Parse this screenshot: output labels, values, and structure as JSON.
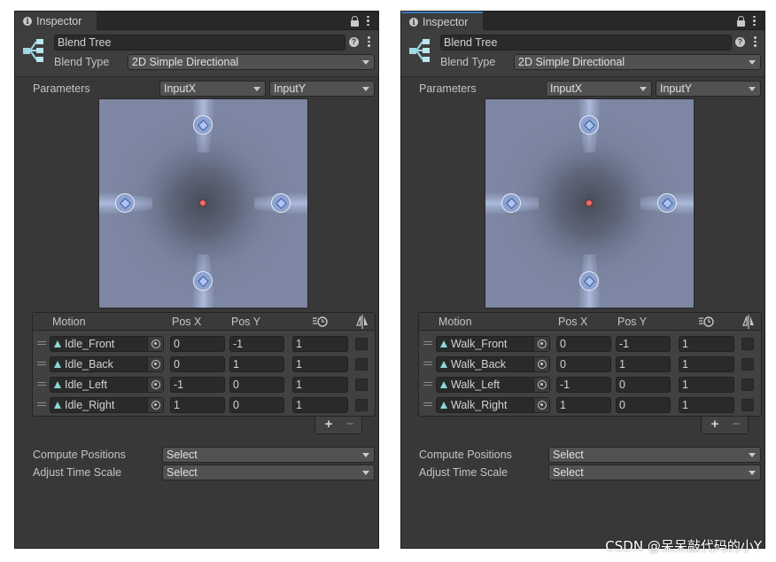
{
  "panels": [
    {
      "tab_label": "Inspector",
      "name": "Blend Tree",
      "blend_type_label": "Blend Type",
      "blend_type_value": "2D Simple Directional",
      "parameters_label": "Parameters",
      "param_x": "InputX",
      "param_y": "InputY",
      "columns": {
        "motion": "Motion",
        "pos_x": "Pos X",
        "pos_y": "Pos Y"
      },
      "motions": [
        {
          "clip": "Idle_Front",
          "pos_x": "0",
          "pos_y": "-1",
          "speed": "1"
        },
        {
          "clip": "Idle_Back",
          "pos_x": "0",
          "pos_y": "1",
          "speed": "1"
        },
        {
          "clip": "Idle_Left",
          "pos_x": "-1",
          "pos_y": "0",
          "speed": "1"
        },
        {
          "clip": "Idle_Right",
          "pos_x": "1",
          "pos_y": "0",
          "speed": "1"
        }
      ],
      "add_label": "+",
      "remove_label": "−",
      "compute_positions_label": "Compute Positions",
      "compute_positions_value": "Select",
      "adjust_time_scale_label": "Adjust Time Scale",
      "adjust_time_scale_value": "Select"
    },
    {
      "tab_label": "Inspector",
      "name": "Blend Tree",
      "blend_type_label": "Blend Type",
      "blend_type_value": "2D Simple Directional",
      "parameters_label": "Parameters",
      "param_x": "InputX",
      "param_y": "InputY",
      "columns": {
        "motion": "Motion",
        "pos_x": "Pos X",
        "pos_y": "Pos Y"
      },
      "motions": [
        {
          "clip": "Walk_Front",
          "pos_x": "0",
          "pos_y": "-1",
          "speed": "1"
        },
        {
          "clip": "Walk_Back",
          "pos_x": "0",
          "pos_y": "1",
          "speed": "1"
        },
        {
          "clip": "Walk_Left",
          "pos_x": "-1",
          "pos_y": "0",
          "speed": "1"
        },
        {
          "clip": "Walk_Right",
          "pos_x": "1",
          "pos_y": "0",
          "speed": "1"
        }
      ],
      "add_label": "+",
      "remove_label": "−",
      "compute_positions_label": "Compute Positions",
      "compute_positions_value": "Select",
      "adjust_time_scale_label": "Adjust Time Scale",
      "adjust_time_scale_value": "Select"
    }
  ],
  "watermark": "CSDN @呆呆敲代码的小Y",
  "icons": {
    "tab": "info-icon",
    "lock": "lock-icon",
    "menu": "kebab-icon",
    "help": "help-icon",
    "blend_tree": "blend-tree-icon",
    "clip": "animation-clip-icon",
    "picker": "object-picker-icon",
    "timescale": "time-scale-icon",
    "mirror": "mirror-icon"
  },
  "colors": {
    "panel_bg": "#383838",
    "viz_bg": "#7a839e",
    "node": "#8ea3cf",
    "center_point": "#ef6d6d",
    "clip_icon": "#8bd8d6"
  }
}
